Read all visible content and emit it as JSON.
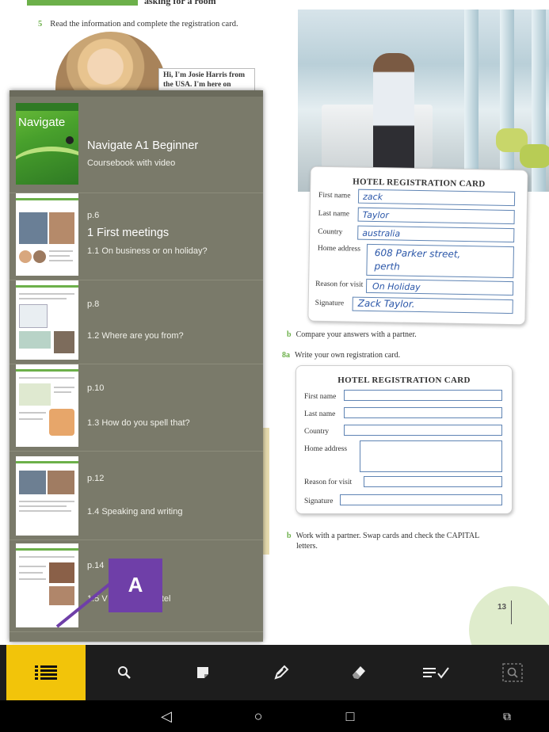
{
  "book_page": {
    "top_banner_text": "asking for a room",
    "exercise_5": {
      "number": "5",
      "text": "Read the information and complete the registration card."
    },
    "josie_bubble": "Hi, I'm Josie Harris from the USA. I'm here on",
    "filled_card": {
      "title": "HOTEL REGISTRATION CARD",
      "labels": [
        "First name",
        "Last name",
        "Country",
        "Home address",
        "Reason for visit",
        "Signature"
      ],
      "values": [
        "zack",
        "Taylor",
        "australia",
        "608 Parker street,",
        "perth",
        "On Holiday",
        "Zack Taylor."
      ]
    },
    "exercise_b1": {
      "number": "b",
      "text": "Compare your answers with a partner."
    },
    "exercise_8a": {
      "number": "8a",
      "text": "Write your own registration card."
    },
    "empty_card": {
      "title": "HOTEL REGISTRATION CARD",
      "labels": [
        "First name",
        "Last name",
        "Country",
        "Home address",
        "Reason for visit",
        "Signature"
      ]
    },
    "exercise_b2": {
      "number": "b",
      "text_line1": "Work with a partner. Swap cards and check the CAPITAL",
      "text_line2": "letters."
    },
    "page_number": "13"
  },
  "toc": {
    "book": {
      "cover_logo": "Navigate",
      "title": "Navigate A1 Beginner",
      "subtitle": "Coursebook with video"
    },
    "items": [
      {
        "page": "p.6",
        "unit": "1 First meetings",
        "lesson": "1.1 On business or on holiday?"
      },
      {
        "page": "p.8",
        "lesson": "1.2 Where are you from?"
      },
      {
        "page": "p.10",
        "lesson": "1.3 How do you spell that?"
      },
      {
        "page": "p.12",
        "lesson": "1.4 Speaking and writing"
      },
      {
        "page": "p.14",
        "lesson": "1.5 V",
        "lesson_tail": "otel"
      }
    ]
  },
  "annotation": {
    "label": "A",
    "color": "#6f3fa8"
  },
  "toolbar": {
    "active_color": "#f2c40a",
    "buttons": [
      {
        "icon": "table-of-contents-icon",
        "active": true
      },
      {
        "icon": "search-icon"
      },
      {
        "icon": "note-icon"
      },
      {
        "icon": "pen-icon"
      },
      {
        "icon": "eraser-icon"
      },
      {
        "icon": "checklist-icon"
      },
      {
        "icon": "zoom-region-icon"
      }
    ]
  },
  "android_nav": {
    "buttons": [
      {
        "icon": "back-icon",
        "glyph": "◁"
      },
      {
        "icon": "home-icon",
        "glyph": "○"
      },
      {
        "icon": "recents-icon",
        "glyph": "□"
      },
      {
        "icon": "screenshot-icon",
        "glyph": "⧉"
      }
    ]
  }
}
